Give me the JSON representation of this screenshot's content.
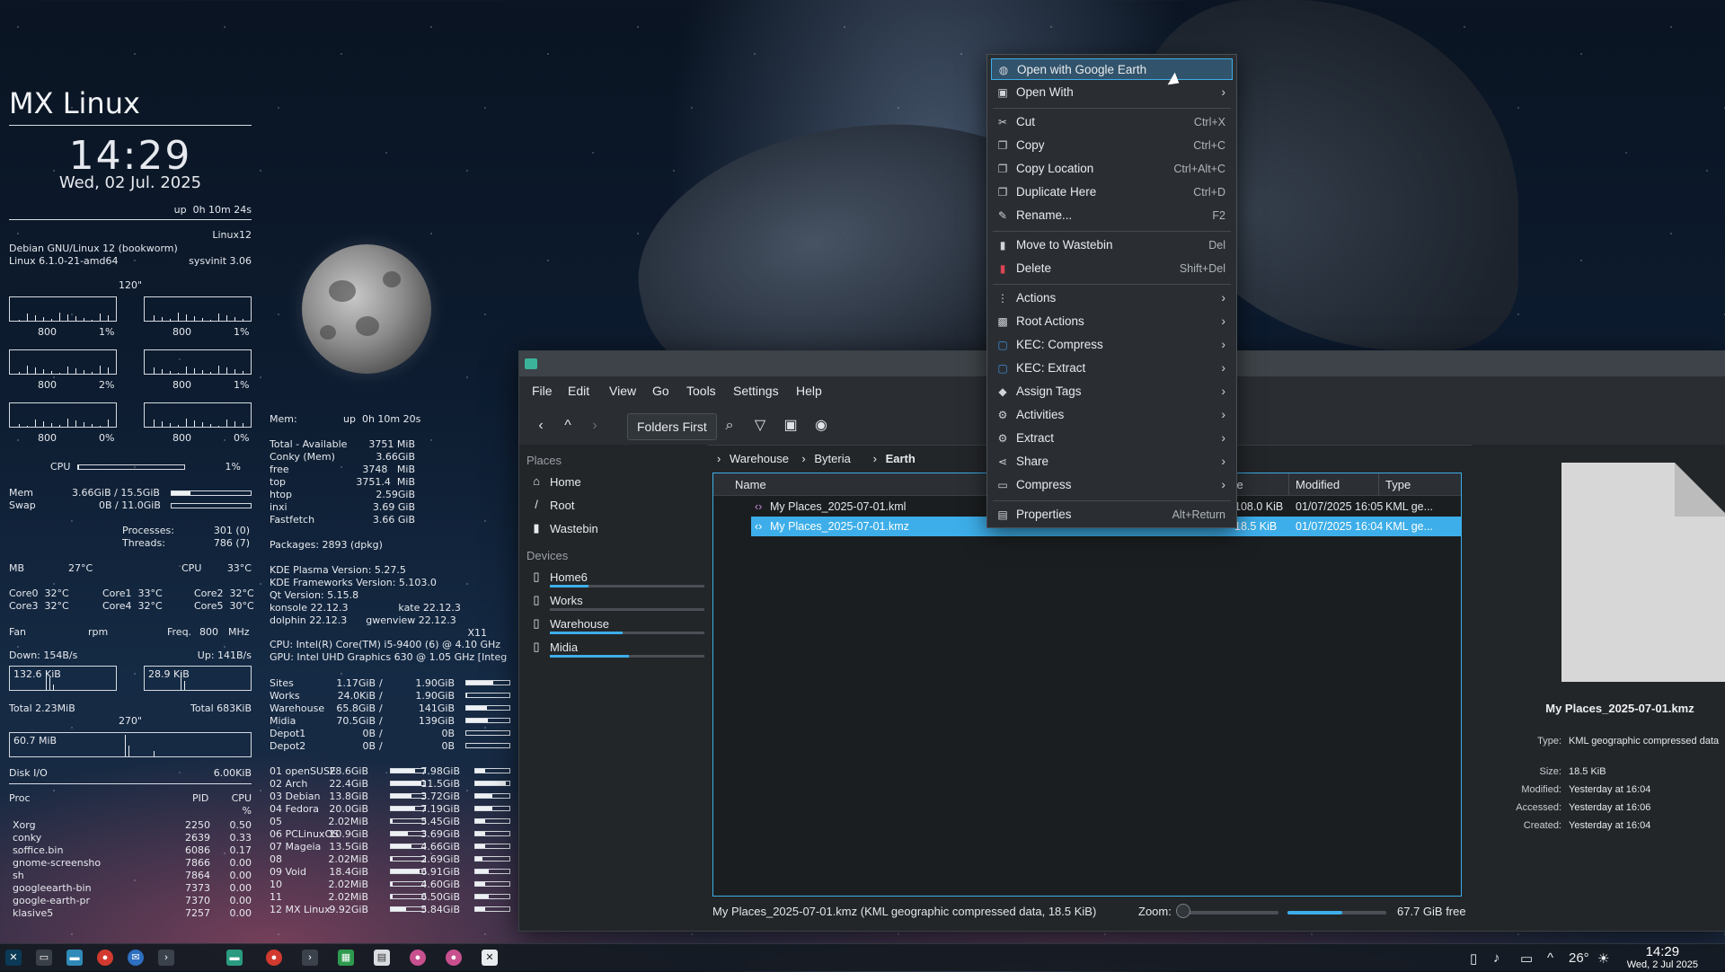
{
  "conky": {
    "title": "MX Linux",
    "time": "14:29",
    "date": "Wed, 02 Jul. 2025",
    "uptime": "up  0h 10m 24s",
    "host": "Linux12",
    "distro": "Debian GNU/Linux 12 (bookworm)",
    "kernel": "Linux 6.1.0-21-amd64",
    "init": "sysvinit 3.06",
    "cpu_freq_label": "120\"",
    "cpu_graphs": [
      {
        "freq": "800",
        "pct": "1%"
      },
      {
        "freq": "800",
        "pct": "1%"
      },
      {
        "freq": "800",
        "pct": "2%"
      },
      {
        "freq": "800",
        "pct": "1%"
      },
      {
        "freq": "800",
        "pct": "0%"
      },
      {
        "freq": "800",
        "pct": "0%"
      }
    ],
    "cpu_label": "CPU",
    "cpu_pct": "1%",
    "cpu_level": 0.01,
    "mem_label": "Mem",
    "mem_value": "3.66GiB / 15.5GiB",
    "mem_level": 0.24,
    "swap_label": "Swap",
    "swap_value": "0B / 11.0GiB",
    "swap_level": 0.0,
    "processes_label": "Processes:",
    "processes": "301 (0)",
    "threads_label": "Threads:",
    "threads": "786 (7)",
    "mb_label": "MB",
    "mb_temp": "27°C",
    "cpu_temp_label": "CPU",
    "cpu_temp": "33°C",
    "cores": [
      "Core0  32°C",
      "Core1  33°C",
      "Core2  32°C",
      "Core3  32°C",
      "Core4  32°C",
      "Core5  30°C"
    ],
    "fan_label": "Fan",
    "fan_unit": "rpm",
    "freq_label": "Freq.",
    "freq_value": "800",
    "freq_unit": "MHz",
    "down": "Down: 154B/s",
    "up": "Up: 141B/s",
    "down_graph": "132.6 KiB",
    "up_graph": "28.9 KiB",
    "total_down": "Total 2.23MiB",
    "total_up": "Total 683KiB",
    "disk_label": "270\"",
    "disk_graph": "60.7 MiB",
    "disk_io_label": "Disk I/O",
    "disk_io": "6.00KiB",
    "proc_header": {
      "name": "Proc",
      "pid": "PID",
      "cpu": "CPU",
      "pct": "%"
    },
    "procs": [
      {
        "name": "Xorg",
        "pid": "2250",
        "cpu": "0.50"
      },
      {
        "name": "conky",
        "pid": "2639",
        "cpu": "0.33"
      },
      {
        "name": "soffice.bin",
        "pid": "6086",
        "cpu": "0.17"
      },
      {
        "name": "gnome-screensho",
        "pid": "7866",
        "cpu": "0.00"
      },
      {
        "name": "sh",
        "pid": "7864",
        "cpu": "0.00"
      },
      {
        "name": "googleearth-bin",
        "pid": "7373",
        "cpu": "0.00"
      },
      {
        "name": "google-earth-pr",
        "pid": "7370",
        "cpu": "0.00"
      },
      {
        "name": "klasive5",
        "pid": "7257",
        "cpu": "0.00"
      }
    ]
  },
  "conky2": {
    "mem_header": "Mem:",
    "uptime": "up  0h 10m 20s",
    "mem_rows": [
      {
        "k": "Total - Available",
        "v": "3751 MiB"
      },
      {
        "k": "Conky (Mem)",
        "v": "3.66GiB"
      },
      {
        "k": "free",
        "v": "3748   MiB"
      },
      {
        "k": "top",
        "v": "3751.4  MiB"
      },
      {
        "k": "htop",
        "v": "2.59GiB"
      },
      {
        "k": "inxi",
        "v": "3.69 GiB"
      },
      {
        "k": "Fastfetch",
        "v": "3.66 GiB"
      }
    ],
    "packages": "Packages: 2893 (dpkg)",
    "versions": [
      "KDE Plasma Version: 5.27.5",
      "KDE Frameworks Version: 5.103.0",
      "Qt Version: 5.15.8",
      "konsole 22.12.3                kate 22.12.3",
      "dolphin 22.12.3      gwenview 22.12.3"
    ],
    "x11": "X11",
    "cpu_line": "CPU: Intel(R) Core(TM) i5-9400 (6) @ 4.10 GHz",
    "gpu_line": "GPU: Intel UHD Graphics 630 @ 1.05 GHz [Integ",
    "drives": [
      {
        "name": "Sites",
        "used": "1.17GiB",
        "size": "1.90GiB",
        "level": 0.62
      },
      {
        "name": "Works",
        "used": "24.0KiB",
        "size": "1.90GiB",
        "level": 0.02
      },
      {
        "name": "Warehouse",
        "used": "65.8GiB",
        "size": "141GiB",
        "level": 0.47
      },
      {
        "name": "Midia",
        "used": "70.5GiB",
        "size": "139GiB",
        "level": 0.51
      },
      {
        "name": "Depot1",
        "used": "0B",
        "size": "0B",
        "level": 0
      },
      {
        "name": "Depot2",
        "used": "0B",
        "size": "0B",
        "level": 0
      }
    ],
    "distros": [
      {
        "name": "01 openSUSE",
        "a": "28.6GiB",
        "al": 0.7,
        "b": "7.98GiB",
        "bl": 0.3
      },
      {
        "name": "02 Arch",
        "a": "22.4GiB",
        "al": 0.9,
        "b": "11.5GiB",
        "bl": 0.9
      },
      {
        "name": "03 Debian",
        "a": "13.8GiB",
        "al": 0.6,
        "b": "3.72GiB",
        "bl": 0.5
      },
      {
        "name": "04 Fedora",
        "a": "20.0GiB",
        "al": 0.7,
        "b": "7.19GiB",
        "bl": 0.5
      },
      {
        "name": "05",
        "a": "2.02MiB",
        "al": 0.05,
        "b": "5.45GiB",
        "bl": 0.3
      },
      {
        "name": "06 PCLinuxOS",
        "a": "10.9GiB",
        "al": 0.5,
        "b": "3.69GiB",
        "bl": 0.3
      },
      {
        "name": "07 Mageia",
        "a": "13.5GiB",
        "al": 0.6,
        "b": "4.66GiB",
        "bl": 0.3
      },
      {
        "name": "08",
        "a": "2.02MiB",
        "al": 0.05,
        "b": "2.69GiB",
        "bl": 0.2
      },
      {
        "name": "09 Void",
        "a": "18.4GiB",
        "al": 0.85,
        "b": "6.91GiB",
        "bl": 0.4
      },
      {
        "name": "10",
        "a": "2.02MiB",
        "al": 0.05,
        "b": "4.60GiB",
        "bl": 0.3
      },
      {
        "name": "11",
        "a": "2.02MiB",
        "al": 0.05,
        "b": "6.50GiB",
        "bl": 0.4
      },
      {
        "name": "12 MX Linux",
        "a": "9.92GiB",
        "al": 0.45,
        "b": "5.84GiB",
        "bl": 0.3
      }
    ]
  },
  "filemanager": {
    "menus": [
      "File",
      "Edit",
      "View",
      "Go",
      "Tools",
      "Settings",
      "Help"
    ],
    "folders_first": "Folders First",
    "places_header": "Places",
    "places": [
      {
        "label": "Home",
        "icon": "home-icon"
      },
      {
        "label": "Root",
        "icon": "root-slash-icon"
      },
      {
        "label": "Wastebin",
        "icon": "trash-icon"
      }
    ],
    "devices_header": "Devices",
    "devices": [
      {
        "label": "Home6",
        "usage": 0.25
      },
      {
        "label": "Works",
        "usage": 0.0
      },
      {
        "label": "Warehouse",
        "usage": 0.47
      },
      {
        "label": "Midia",
        "usage": 0.51
      }
    ],
    "breadcrumbs": [
      "Warehouse",
      "Byteria",
      "Earth"
    ],
    "columns": {
      "name": "Name",
      "size": "ze",
      "modified": "Modified",
      "type": "Type"
    },
    "files": [
      {
        "name": "My Places_2025-07-01.kml",
        "size": "108.0 KiB",
        "modified": "01/07/2025 16:05",
        "type": "KML ge...",
        "selected": false
      },
      {
        "name": "My Places_2025-07-01.kmz",
        "size": "18.5 KiB",
        "modified": "01/07/2025 16:04",
        "type": "KML ge...",
        "selected": true
      }
    ],
    "status": "My Places_2025-07-01.kmz (KML geographic compressed data, 18.5 KiB)",
    "zoom_label": "Zoom:",
    "free_space": "67.7 GiB free",
    "info": {
      "filename": "My Places_2025-07-01.kmz",
      "rows": [
        {
          "k": "Type:",
          "v": "KML geographic compressed data"
        },
        {
          "k": "Size:",
          "v": "18.5 KiB"
        },
        {
          "k": "Modified:",
          "v": "Yesterday at 16:04"
        },
        {
          "k": "Accessed:",
          "v": "Yesterday at 16:06"
        },
        {
          "k": "Created:",
          "v": "Yesterday at 16:04"
        }
      ]
    }
  },
  "context_menu": {
    "items": [
      {
        "label": "Open with Google Earth",
        "icon": "google-earth-icon",
        "shortcut": "",
        "submenu": false,
        "highlight": true
      },
      {
        "label": "Open With",
        "icon": "open-with-icon",
        "shortcut": "",
        "submenu": true
      },
      {
        "sep": true
      },
      {
        "label": "Cut",
        "icon": "scissors-icon",
        "shortcut": "Ctrl+X",
        "submenu": false
      },
      {
        "label": "Copy",
        "icon": "copy-icon",
        "shortcut": "Ctrl+C",
        "submenu": false
      },
      {
        "label": "Copy Location",
        "icon": "copy-location-icon",
        "shortcut": "Ctrl+Alt+C",
        "submenu": false
      },
      {
        "label": "Duplicate Here",
        "icon": "duplicate-icon",
        "shortcut": "Ctrl+D",
        "submenu": false
      },
      {
        "label": "Rename...",
        "icon": "rename-pencil-icon",
        "shortcut": "F2",
        "submenu": false
      },
      {
        "sep": true
      },
      {
        "label": "Move to Wastebin",
        "icon": "trash-icon",
        "shortcut": "Del",
        "submenu": false
      },
      {
        "label": "Delete",
        "icon": "delete-icon",
        "shortcut": "Shift+Del",
        "submenu": false
      },
      {
        "sep": true
      },
      {
        "label": "Actions",
        "icon": "actions-icon",
        "shortcut": "",
        "submenu": true
      },
      {
        "label": "Root Actions",
        "icon": "root-actions-icon",
        "shortcut": "",
        "submenu": true
      },
      {
        "label": "KEC: Compress",
        "icon": "kec-compress-icon",
        "shortcut": "",
        "submenu": true
      },
      {
        "label": "KEC: Extract",
        "icon": "kec-extract-icon",
        "shortcut": "",
        "submenu": true
      },
      {
        "label": "Assign Tags",
        "icon": "tag-icon",
        "shortcut": "",
        "submenu": true
      },
      {
        "label": "Activities",
        "icon": "activities-icon",
        "shortcut": "",
        "submenu": true
      },
      {
        "label": "Extract",
        "icon": "extract-icon",
        "shortcut": "",
        "submenu": true
      },
      {
        "label": "Share",
        "icon": "share-icon",
        "shortcut": "",
        "submenu": true
      },
      {
        "label": "Compress",
        "icon": "compress-icon",
        "shortcut": "",
        "submenu": true
      },
      {
        "sep": true
      },
      {
        "label": "Properties",
        "icon": "properties-icon",
        "shortcut": "Alt+Return",
        "submenu": false
      }
    ]
  },
  "taskbar": {
    "weather": "26°",
    "time": "14:29",
    "date": "Wed, 2 Jul 2025"
  }
}
